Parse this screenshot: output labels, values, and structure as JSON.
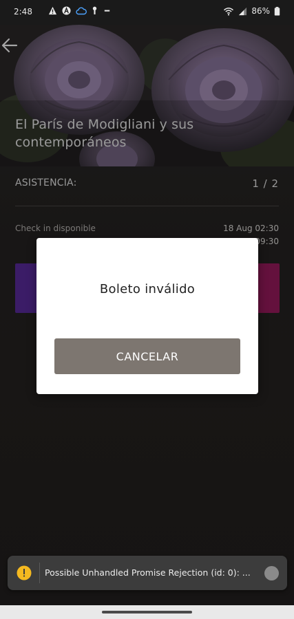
{
  "status_bar": {
    "time": "2:48",
    "battery": "86%",
    "icons_left": [
      "warning-icon",
      "a-icon",
      "cloud-icon",
      "key-icon",
      "dash-icon"
    ],
    "icons_right": [
      "wifi-icon",
      "signal-icon",
      "battery-icon"
    ]
  },
  "event": {
    "title": "El París de Modigliani y sus contemporáneos"
  },
  "attendance": {
    "label": "ASISTENCIA:",
    "count": "1 / 2"
  },
  "checkin": {
    "label": "Check in disponible",
    "date_start": "18 Aug 02:30",
    "date_end": "09:30"
  },
  "dialog": {
    "message": "Boleto inválido",
    "cancel_label": "CANCELAR"
  },
  "warning": {
    "text": "Possible Unhandled Promise Rejection (id: 0): ..."
  },
  "colors": {
    "purple": "#5b2c9f",
    "magenta": "#9a1b5e",
    "cancel_button": "#7d7670",
    "warning_yellow": "#f5b920"
  }
}
